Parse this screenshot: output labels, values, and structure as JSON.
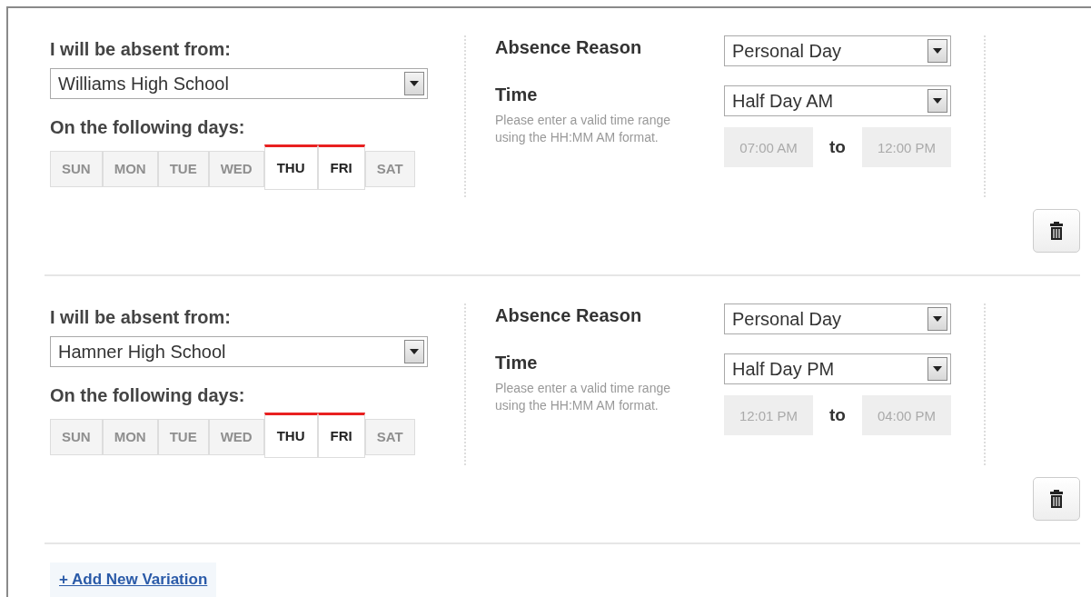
{
  "variations": [
    {
      "school_label": "I will be absent from:",
      "school": "Williams High School",
      "days_label": "On the following days:",
      "days": [
        {
          "label": "SUN",
          "selected": false
        },
        {
          "label": "MON",
          "selected": false
        },
        {
          "label": "TUE",
          "selected": false
        },
        {
          "label": "WED",
          "selected": false
        },
        {
          "label": "THU",
          "selected": true
        },
        {
          "label": "FRI",
          "selected": true
        },
        {
          "label": "SAT",
          "selected": false
        }
      ],
      "reason_label": "Absence Reason",
      "reason": "Personal Day",
      "time_label": "Time",
      "time": "Half Day AM",
      "time_hint": "Please enter a valid time range using the HH:MM AM format.",
      "start": "07:00 AM",
      "to": "to",
      "end": "12:00 PM"
    },
    {
      "school_label": "I will be absent from:",
      "school": "Hamner High School",
      "days_label": "On the following days:",
      "days": [
        {
          "label": "SUN",
          "selected": false
        },
        {
          "label": "MON",
          "selected": false
        },
        {
          "label": "TUE",
          "selected": false
        },
        {
          "label": "WED",
          "selected": false
        },
        {
          "label": "THU",
          "selected": true
        },
        {
          "label": "FRI",
          "selected": true
        },
        {
          "label": "SAT",
          "selected": false
        }
      ],
      "reason_label": "Absence Reason",
      "reason": "Personal Day",
      "time_label": "Time",
      "time": "Half Day PM",
      "time_hint": "Please enter a valid time range using the HH:MM AM format.",
      "start": "12:01 PM",
      "to": "to",
      "end": "04:00 PM"
    }
  ],
  "add_link": "+ Add New Variation"
}
